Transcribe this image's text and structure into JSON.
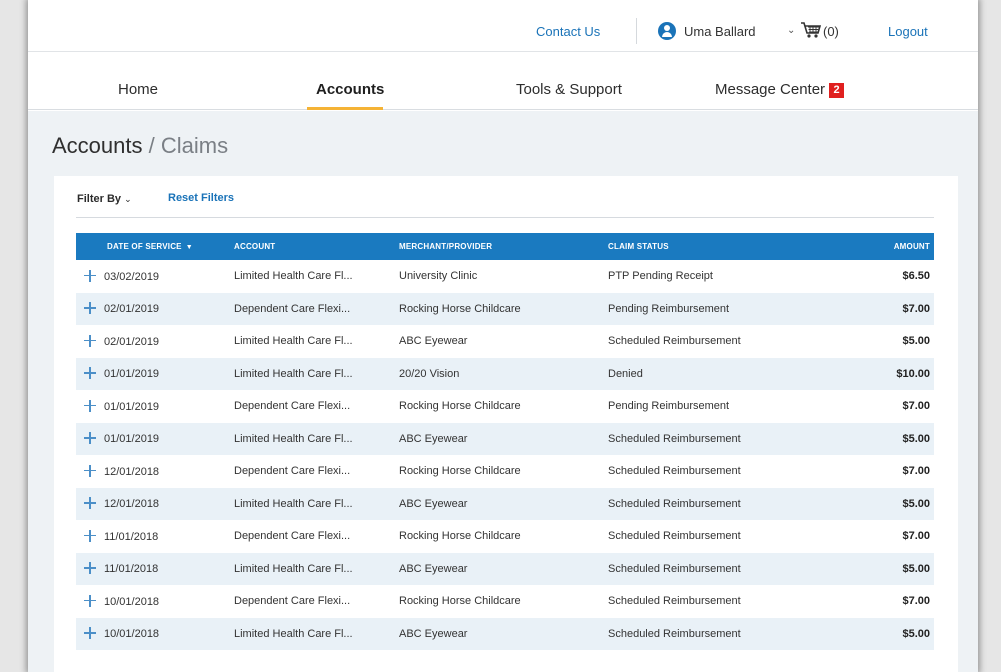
{
  "header": {
    "contact_label": "Contact Us",
    "user_name": "Uma Ballard",
    "cart_count": "(0)",
    "logout_label": "Logout"
  },
  "nav": {
    "items": [
      {
        "label": "Home"
      },
      {
        "label": "Accounts",
        "active": true
      },
      {
        "label": "Tools & Support"
      },
      {
        "label": "Message Center",
        "badge": "2"
      }
    ]
  },
  "page": {
    "title_main": "Accounts",
    "title_sep": " / ",
    "title_sub": "Claims"
  },
  "filters": {
    "filter_by_label": "Filter By",
    "reset_label": "Reset Filters"
  },
  "table": {
    "columns": [
      "DATE OF SERVICE",
      "ACCOUNT",
      "MERCHANT/PROVIDER",
      "CLAIM STATUS",
      "AMOUNT"
    ],
    "sort_indicator": "▼",
    "rows": [
      {
        "date": "03/02/2019",
        "account": "Limited Health Care Fl...",
        "merchant": "University Clinic",
        "status": "PTP Pending Receipt",
        "amount": "$6.50"
      },
      {
        "date": "02/01/2019",
        "account": "Dependent Care Flexi...",
        "merchant": "Rocking Horse Childcare",
        "status": "Pending Reimbursement",
        "amount": "$7.00"
      },
      {
        "date": "02/01/2019",
        "account": "Limited Health Care Fl...",
        "merchant": "ABC Eyewear",
        "status": "Scheduled Reimbursement",
        "amount": "$5.00"
      },
      {
        "date": "01/01/2019",
        "account": "Limited Health Care Fl...",
        "merchant": "20/20 Vision",
        "status": "Denied",
        "amount": "$10.00"
      },
      {
        "date": "01/01/2019",
        "account": "Dependent Care Flexi...",
        "merchant": "Rocking Horse Childcare",
        "status": "Pending Reimbursement",
        "amount": "$7.00"
      },
      {
        "date": "01/01/2019",
        "account": "Limited Health Care Fl...",
        "merchant": "ABC Eyewear",
        "status": "Scheduled Reimbursement",
        "amount": "$5.00"
      },
      {
        "date": "12/01/2018",
        "account": "Dependent Care Flexi...",
        "merchant": "Rocking Horse Childcare",
        "status": "Scheduled Reimbursement",
        "amount": "$7.00"
      },
      {
        "date": "12/01/2018",
        "account": "Limited Health Care Fl...",
        "merchant": "ABC Eyewear",
        "status": "Scheduled Reimbursement",
        "amount": "$5.00"
      },
      {
        "date": "11/01/2018",
        "account": "Dependent Care Flexi...",
        "merchant": "Rocking Horse Childcare",
        "status": "Scheduled Reimbursement",
        "amount": "$7.00"
      },
      {
        "date": "11/01/2018",
        "account": "Limited Health Care Fl...",
        "merchant": "ABC Eyewear",
        "status": "Scheduled Reimbursement",
        "amount": "$5.00"
      },
      {
        "date": "10/01/2018",
        "account": "Dependent Care Flexi...",
        "merchant": "Rocking Horse Childcare",
        "status": "Scheduled Reimbursement",
        "amount": "$7.00"
      },
      {
        "date": "10/01/2018",
        "account": "Limited Health Care Fl...",
        "merchant": "ABC Eyewear",
        "status": "Scheduled Reimbursement",
        "amount": "$5.00"
      }
    ]
  },
  "colors": {
    "link_blue": "#1a73b8",
    "table_header_blue": "#1a7ac0",
    "nav_active_underline": "#f5b335",
    "badge_red": "#e0201f",
    "stripe": "#e9f1f7"
  },
  "icons": [
    "user-avatar-icon",
    "chevron-down-icon",
    "cart-icon",
    "sort-desc-icon",
    "expand-plus-icon"
  ]
}
